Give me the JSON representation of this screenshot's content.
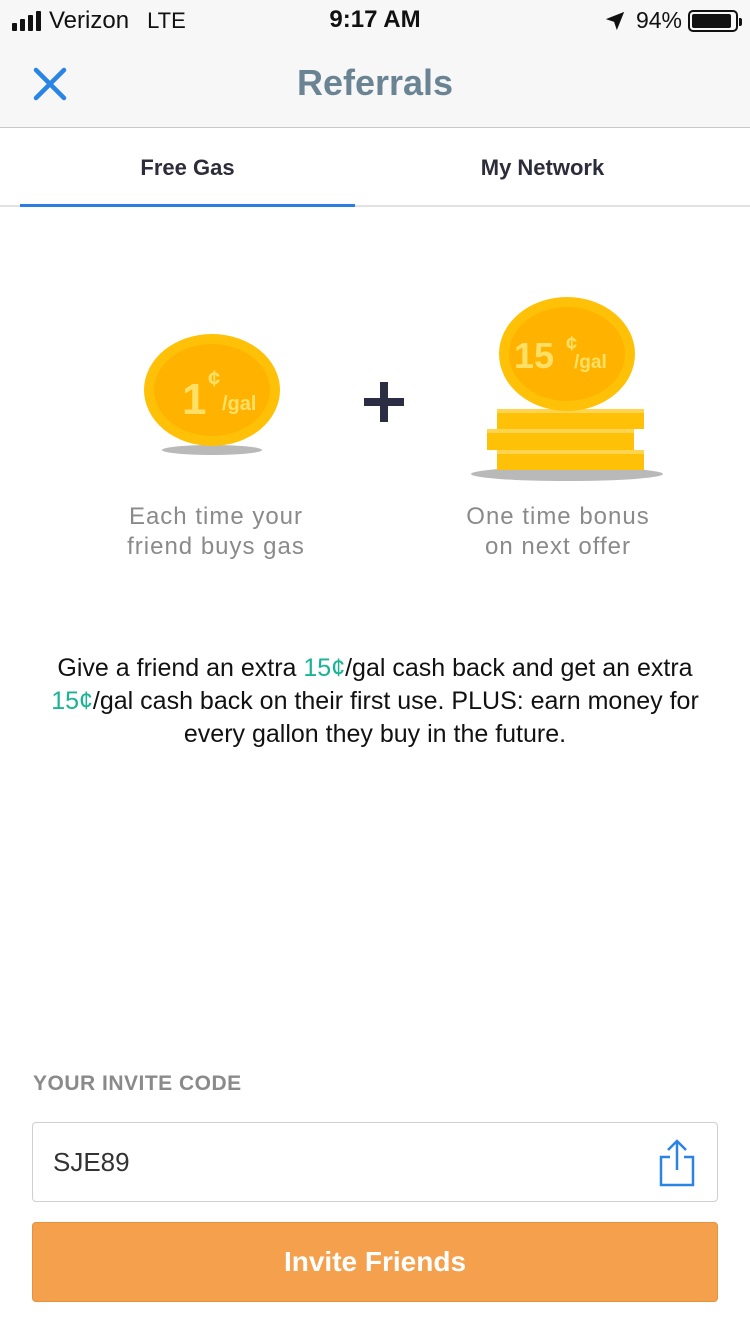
{
  "status_bar": {
    "carrier": "Verizon",
    "network": "LTE",
    "time": "9:17 AM",
    "battery": "94%",
    "battery_level": 0.94
  },
  "nav": {
    "title": "Referrals",
    "close_icon": "close-x-icon"
  },
  "tabs": [
    {
      "label": "Free Gas",
      "active": true
    },
    {
      "label": "My Network",
      "active": false
    }
  ],
  "hero": {
    "left": {
      "amount": "1",
      "cent": "¢",
      "unit": "/gal",
      "caption_line1": "Each time your",
      "caption_line2": "friend buys gas"
    },
    "operator": "+",
    "right": {
      "amount": "15",
      "cent": "¢",
      "unit": "/gal",
      "caption_line1": "One time bonus",
      "caption_line2": "on next offer"
    }
  },
  "description": {
    "p1": "Give a friend an extra ",
    "a1": "15¢",
    "p2": "/gal cash back and get an extra ",
    "a2": "15¢",
    "p3": "/gal cash back on their first use. PLUS: earn money for every gallon they buy in the future."
  },
  "invite": {
    "label": "YOUR INVITE CODE",
    "code": "SJE89",
    "share_icon": "share-icon",
    "button_label": "Invite Friends"
  },
  "colors": {
    "accent_green": "#1ab393",
    "tab_indicator": "#2a7de1",
    "button_orange": "#f4a04c",
    "coin_gold": "#ffc107",
    "coin_inner": "#ffb300",
    "title_slate": "#6b8494"
  }
}
